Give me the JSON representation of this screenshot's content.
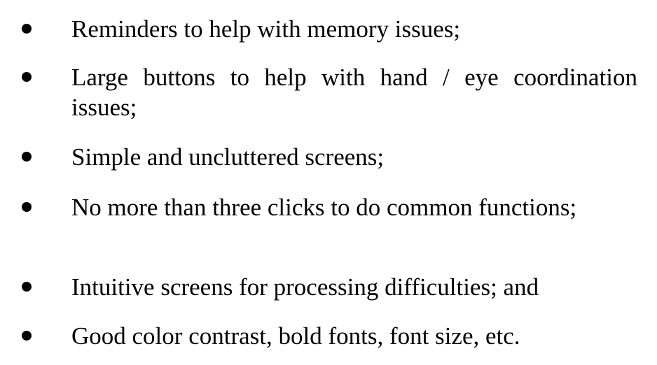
{
  "document": {
    "bullets": [
      {
        "text": "Reminders to help with memory issues;"
      },
      {
        "text": "Large buttons to help with hand / eye coordination issues;"
      },
      {
        "text": "Simple and uncluttered screens;"
      },
      {
        "text": "No more than three clicks to do common functions;"
      },
      {
        "text": "Intuitive screens for processing difficulties; and"
      },
      {
        "text": "Good color contrast, bold fonts, font size, etc."
      }
    ]
  }
}
